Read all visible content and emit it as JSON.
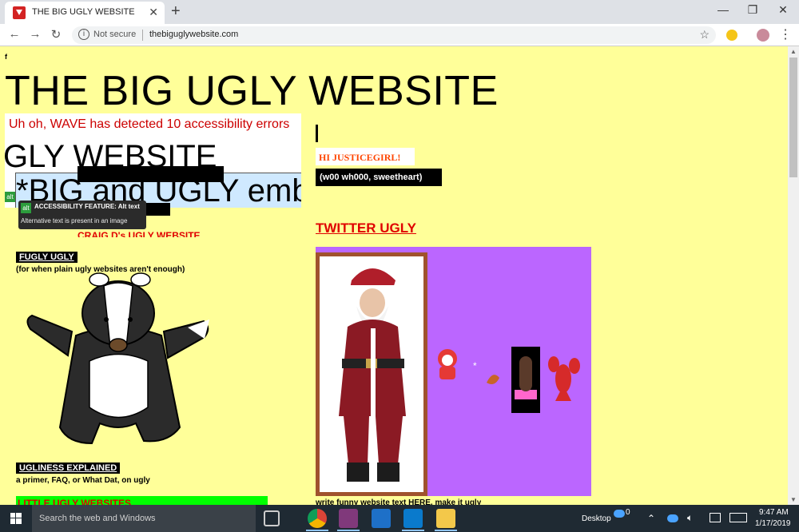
{
  "browser": {
    "tab_title": "THE BIG UGLY WEBSITE",
    "tab_close": "✕",
    "new_tab": "+",
    "window_controls": {
      "minimize": "—",
      "maximize": "❐",
      "close": "✕"
    },
    "nav": {
      "back": "←",
      "forward": "→",
      "reload": "↻"
    },
    "security_label": "Not secure",
    "url": "thebiguglywebsite.com",
    "bookmark_icon": "☆",
    "menu_icon": "⋮"
  },
  "page": {
    "stray_letter": "f",
    "title": "THE BIG UGLY WEBSITE",
    "wave_banner": "Uh oh, WAVE has detected 10 accessibility errors",
    "embed_text_top": "GLY WEBSITE",
    "embed_text_inner": "*BIG and UGLY emb",
    "alt_badge": "alt",
    "tooltip_title": "ACCESSIBILITY FEATURE: Alt text",
    "tooltip_desc": "Alternative text is present in an image",
    "craig_link": "CRAIG D's UGLY WEBSITE",
    "fugly_label": "FUGLY UGLY",
    "fugly_sub": "(for when plain ugly websites aren't enough)",
    "ugliness_label": "UGLINESS EXPLAINED",
    "ugliness_sub": "a primer, FAQ, or What Dat, on ugly",
    "little_ugly": "LITTLE UGLY WEBSITES",
    "hi_text": "HI JUSTICEGIRL!",
    "woo_text": "(w00 wh000, sweetheart)",
    "twitter_link": "TWITTER UGLY",
    "write_funny": "write funny website text HERE, make it ugly"
  },
  "taskbar": {
    "search_placeholder": "Search the web and Windows",
    "desktop_label": "Desktop",
    "time": "9:47 AM",
    "date": "1/17/2019",
    "onedrive_count": "0"
  },
  "colors": {
    "page_bg": "#ffff99",
    "accent_red": "#e00000",
    "purple_panel": "#bb66ff",
    "green_bar": "#00ff00"
  }
}
